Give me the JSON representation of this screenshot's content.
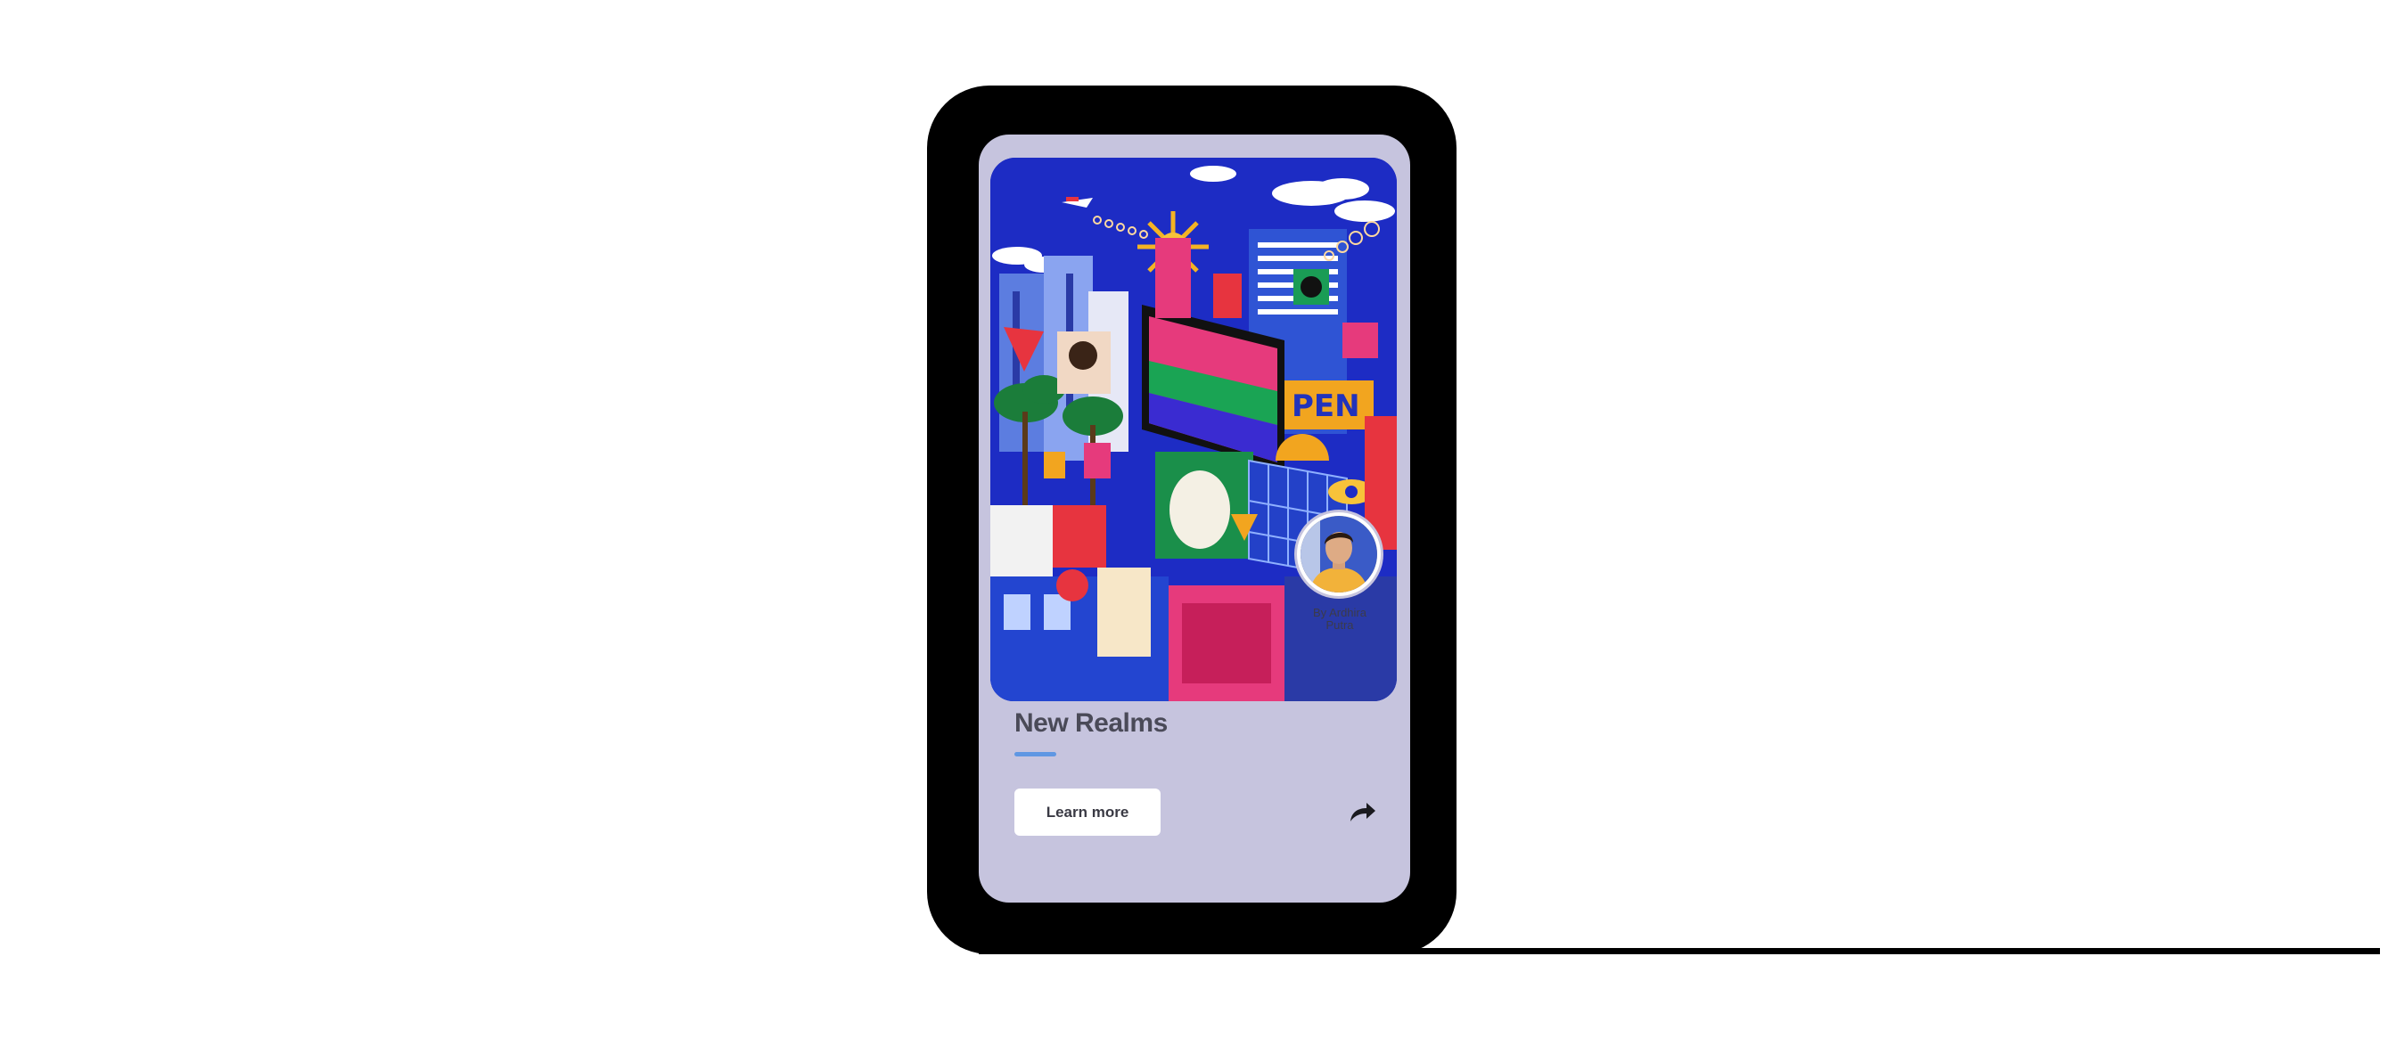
{
  "card": {
    "title": "New Realms",
    "learn_more_label": "Learn more",
    "credit_line1": "By Ardhira",
    "credit_line2": "Putra"
  },
  "icons": {
    "share": "share-arrow-icon",
    "avatar": "artist-avatar"
  },
  "colors": {
    "card_background": "#c6c4de",
    "accent_underline": "#5f97e3",
    "button_background": "#ffffff",
    "title_text": "#4a4a58"
  }
}
